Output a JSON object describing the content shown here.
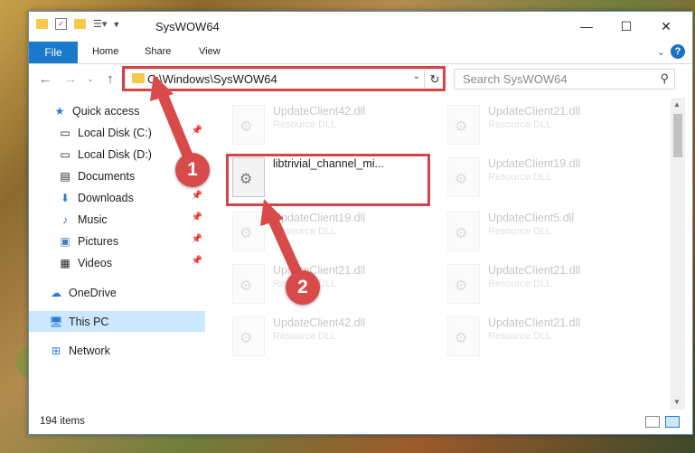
{
  "window": {
    "title": "SysWOW64"
  },
  "ribbon": {
    "tabs": [
      "File",
      "Home",
      "Share",
      "View"
    ],
    "help": "?"
  },
  "address": {
    "path": "C:\\Windows\\SysWOW64"
  },
  "search": {
    "placeholder": "Search SysWOW64"
  },
  "sidebar": {
    "items": [
      {
        "label": "Quick access",
        "icon": "star-icon"
      },
      {
        "label": "Local Disk (C:)",
        "icon": "drive-icon"
      },
      {
        "label": "Local Disk (D:)",
        "icon": "drive-icon"
      },
      {
        "label": "Documents",
        "icon": "documents-icon"
      },
      {
        "label": "Downloads",
        "icon": "download-icon"
      },
      {
        "label": "Music",
        "icon": "music-icon"
      },
      {
        "label": "Pictures",
        "icon": "pictures-icon"
      },
      {
        "label": "Videos",
        "icon": "videos-icon"
      },
      {
        "label": "OneDrive",
        "icon": "cloud-icon"
      },
      {
        "label": "This PC",
        "icon": "computer-icon"
      },
      {
        "label": "Network",
        "icon": "network-icon"
      }
    ]
  },
  "files": [
    {
      "name": "UpdateClient42.dll",
      "type": "Resource DLL"
    },
    {
      "name": "UpdateClient21.dll",
      "type": "Resource DLL"
    },
    {
      "name": "libtrivial_channel_mi...",
      "type": ""
    },
    {
      "name": "UpdateClient19.dll",
      "type": "Resource DLL"
    },
    {
      "name": "UpdateClient19.dll",
      "type": "Resource DLL"
    },
    {
      "name": "UpdateClient5.dll",
      "type": "Resource DLL"
    },
    {
      "name": "UpdateClient21.dll",
      "type": "Resource DLL"
    },
    {
      "name": "UpdateClient21.dll",
      "type": "Resource DLL"
    },
    {
      "name": "UpdateClient42.dll",
      "type": "Resource DLL"
    },
    {
      "name": "UpdateClient21.dll",
      "type": "Resource DLL"
    }
  ],
  "status": {
    "count": "194 items"
  },
  "badges": {
    "one": "1",
    "two": "2"
  },
  "colors": {
    "accent": "#1979ca",
    "highlight": "#d64545",
    "badge": "#d94b4b"
  }
}
